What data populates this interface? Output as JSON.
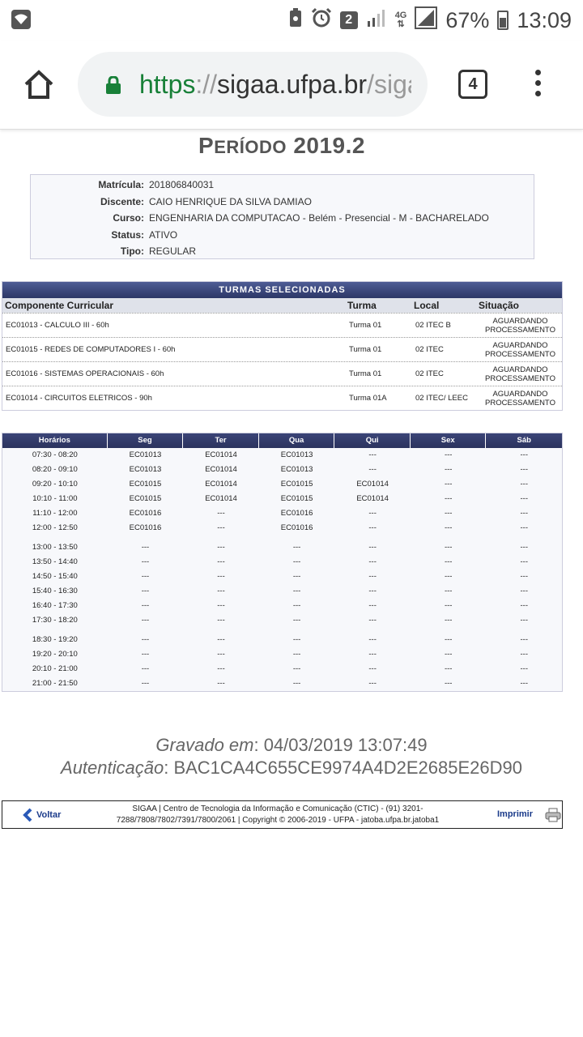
{
  "status_bar": {
    "notif_count": "2",
    "network": "4G",
    "battery": "67%",
    "time": "13:09"
  },
  "browser": {
    "url_scheme": "https",
    "url_sep": "://",
    "url_host": "sigaa.ufpa.br",
    "url_path": "/sigaa",
    "tab_count": "4"
  },
  "page": {
    "title_first": "P",
    "title_rest": "ERÍODO",
    "title_year": "2019.2"
  },
  "info": [
    {
      "label": "Matrícula:",
      "value": "201806840031"
    },
    {
      "label": "Discente:",
      "value": "CAIO HENRIQUE DA SILVA DAMIAO"
    },
    {
      "label": "Curso:",
      "value": "ENGENHARIA DA COMPUTACAO - Belém - Presencial - M - BACHARELADO"
    },
    {
      "label": "Status:",
      "value": "ATIVO"
    },
    {
      "label": "Tipo:",
      "value": "REGULAR"
    }
  ],
  "turmas": {
    "heading": "TURMAS SELECIONADAS",
    "columns": {
      "componente": "Componente Curricular",
      "turma": "Turma",
      "local": "Local",
      "situacao": "Situação"
    },
    "rows": [
      {
        "componente": "EC01013 - CALCULO III - 60h",
        "turma": "Turma 01",
        "local": "02 ITEC B",
        "situacao": "AGUARDANDO PROCESSAMENTO"
      },
      {
        "componente": "EC01015 - REDES DE COMPUTADORES I - 60h",
        "turma": "Turma 01",
        "local": "02 ITEC",
        "situacao": "AGUARDANDO PROCESSAMENTO"
      },
      {
        "componente": "EC01016 - SISTEMAS OPERACIONAIS - 60h",
        "turma": "Turma 01",
        "local": "02 ITEC",
        "situacao": "AGUARDANDO PROCESSAMENTO"
      },
      {
        "componente": "EC01014 - CIRCUITOS ELETRICOS - 90h",
        "turma": "Turma 01A",
        "local": "02 ITEC/ LEEC",
        "situacao": "AGUARDANDO PROCESSAMENTO"
      }
    ]
  },
  "horarios": {
    "columns": [
      "Horários",
      "Seg",
      "Ter",
      "Qua",
      "Qui",
      "Sex",
      "Sáb"
    ],
    "rows": [
      [
        "07:30 - 08:20",
        "EC01013",
        "EC01014",
        "EC01013",
        "---",
        "---",
        "---"
      ],
      [
        "08:20 - 09:10",
        "EC01013",
        "EC01014",
        "EC01013",
        "---",
        "---",
        "---"
      ],
      [
        "09:20 - 10:10",
        "EC01015",
        "EC01014",
        "EC01015",
        "EC01014",
        "---",
        "---"
      ],
      [
        "10:10 - 11:00",
        "EC01015",
        "EC01014",
        "EC01015",
        "EC01014",
        "---",
        "---"
      ],
      [
        "11:10 - 12:00",
        "EC01016",
        "---",
        "EC01016",
        "---",
        "---",
        "---"
      ],
      [
        "12:00 - 12:50",
        "EC01016",
        "---",
        "EC01016",
        "---",
        "---",
        "---"
      ],
      [
        "13:00 - 13:50",
        "---",
        "---",
        "---",
        "---",
        "---",
        "---"
      ],
      [
        "13:50 - 14:40",
        "---",
        "---",
        "---",
        "---",
        "---",
        "---"
      ],
      [
        "14:50 - 15:40",
        "---",
        "---",
        "---",
        "---",
        "---",
        "---"
      ],
      [
        "15:40 - 16:30",
        "---",
        "---",
        "---",
        "---",
        "---",
        "---"
      ],
      [
        "16:40 - 17:30",
        "---",
        "---",
        "---",
        "---",
        "---",
        "---"
      ],
      [
        "17:30 - 18:20",
        "---",
        "---",
        "---",
        "---",
        "---",
        "---"
      ],
      [
        "18:30 - 19:20",
        "---",
        "---",
        "---",
        "---",
        "---",
        "---"
      ],
      [
        "19:20 - 20:10",
        "---",
        "---",
        "---",
        "---",
        "---",
        "---"
      ],
      [
        "20:10 - 21:00",
        "---",
        "---",
        "---",
        "---",
        "---",
        "---"
      ],
      [
        "21:00 - 21:50",
        "---",
        "---",
        "---",
        "---",
        "---",
        "---"
      ]
    ]
  },
  "gravado": {
    "label": "Gravado em",
    "value": ": 04/03/2019 13:07:49",
    "auth_label": "Autenticação",
    "auth_value": ": BAC1CA4C655CE9974A4D2E2685E26D90"
  },
  "footer": {
    "voltar": "Voltar",
    "line1": "SIGAA | Centro de Tecnologia da Informação e Comunicação (CTIC) - (91) 3201-",
    "line2": "7288/7808/7802/7391/7800/2061 | Copyright © 2006-2019 - UFPA - jatoba.ufpa.br.jatoba1",
    "imprimir": "Imprimir"
  }
}
